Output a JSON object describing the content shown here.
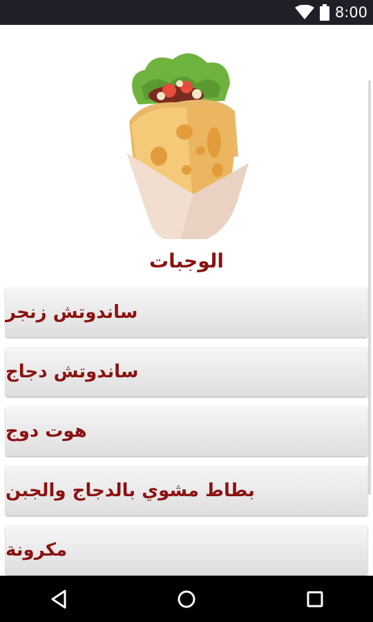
{
  "status_bar": {
    "time": "8:00",
    "icons": [
      "wifi-icon",
      "battery-icon"
    ]
  },
  "page": {
    "title": "الوجبات",
    "hero_image": "wrap-sandwich-illustration"
  },
  "menu": {
    "items": [
      {
        "label": "ساندوتش زنجر"
      },
      {
        "label": "ساندوتش دجاج"
      },
      {
        "label": "هوت دوج"
      },
      {
        "label": "بطاط مشوي بالدجاج والجبن"
      },
      {
        "label": "مكرونة"
      }
    ]
  },
  "nav_bar": {
    "buttons": [
      "back-icon",
      "home-icon",
      "recents-icon"
    ]
  },
  "colors": {
    "accent_text": "#8b1212",
    "status_bar": "#1f1f27",
    "nav_bar": "#000000"
  }
}
